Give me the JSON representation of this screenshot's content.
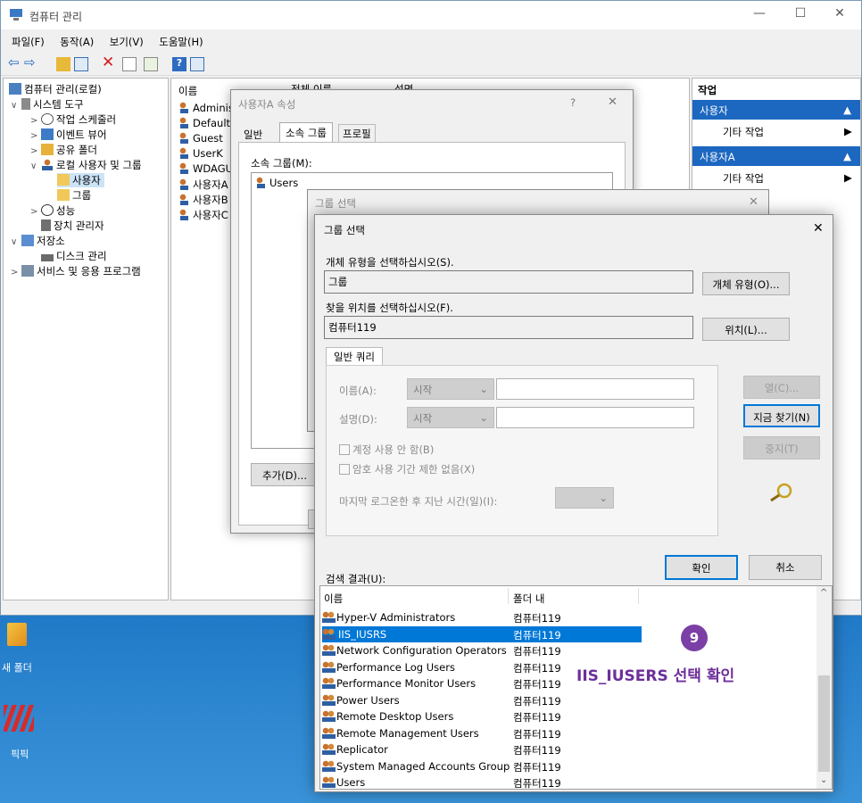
{
  "window": {
    "title": "컴퓨터 관리",
    "controls": [
      "—",
      "☐",
      "✕"
    ]
  },
  "menu": [
    "파일(F)",
    "동작(A)",
    "보기(V)",
    "도움말(H)"
  ],
  "tree": {
    "items": [
      {
        "label": "컴퓨터 관리(로컬)",
        "arrow": ""
      },
      {
        "label": "시스템 도구",
        "arrow": "∨"
      },
      {
        "label": "작업 스케줄러",
        "arrow": ">"
      },
      {
        "label": "이벤트 뷰어",
        "arrow": ">"
      },
      {
        "label": "공유 폴더",
        "arrow": ">"
      },
      {
        "label": "로컬 사용자 및 그룹",
        "arrow": "∨"
      },
      {
        "label": "사용자",
        "arrow": ""
      },
      {
        "label": "그룹",
        "arrow": ""
      },
      {
        "label": "성능",
        "arrow": ">"
      },
      {
        "label": "장치 관리자",
        "arrow": ""
      },
      {
        "label": "저장소",
        "arrow": "∨"
      },
      {
        "label": "디스크 관리",
        "arrow": ""
      },
      {
        "label": "서비스 및 응용 프로그램",
        "arrow": ">"
      }
    ]
  },
  "list": {
    "columns": [
      "이름",
      "전체 이름",
      "설명"
    ],
    "rows": [
      "Adminis",
      "DefaultA",
      "Guest",
      "UserK",
      "WDAGU",
      "사용자A",
      "사용자B",
      "사용자C"
    ]
  },
  "actions": {
    "header": "작업",
    "sections": [
      {
        "title": "사용자",
        "item": "기타 작업"
      },
      {
        "title": "사용자A",
        "item": "기타 작업"
      }
    ]
  },
  "desktop": {
    "folder_label": "새 폴더",
    "app_label": "픽픽"
  },
  "prop_dialog": {
    "title": "사용자A 속성",
    "help": "?",
    "close": "✕",
    "tabs": [
      "일반",
      "소속 그룹",
      "프로필"
    ],
    "member_of_label": "소속 그룹(M):",
    "members": [
      "Users"
    ],
    "add_button": "추가(D)..."
  },
  "group_select_back": {
    "title": "그룹 선택",
    "close": "✕"
  },
  "group_select": {
    "title": "그룹 선택",
    "close": "✕",
    "object_type_label": "개체 유형을 선택하십시오(S).",
    "object_type_value": "그룹",
    "object_type_button": "개체 유형(O)...",
    "location_label": "찾을 위치를 선택하십시오(F).",
    "location_value": "컴퓨터119",
    "location_button": "위치(L)...",
    "query_tab": "일반 쿼리",
    "name_label": "이름(A):",
    "name_combo": "시작",
    "desc_label": "설명(D):",
    "desc_combo": "시작",
    "disabled_accounts": "계정 사용 안 함(B)",
    "no_expire": "암호 사용 기간 제한 없음(X)",
    "last_logon": "마지막 로그온한 후 지난 시간(일)(I):",
    "columns_button": "열(C)...",
    "find_now_button": "지금 찾기(N)",
    "stop_button": "중지(T)",
    "ok_button": "확인",
    "cancel_button": "취소",
    "results_label": "검색 결과(U):",
    "results_columns": [
      "이름",
      "폴더 내"
    ],
    "results": [
      {
        "name": "Hyper-V Administrators",
        "folder": "컴퓨터119"
      },
      {
        "name": "IIS_IUSRS",
        "folder": "컴퓨터119",
        "selected": true
      },
      {
        "name": "Network Configuration Operators",
        "folder": "컴퓨터119"
      },
      {
        "name": "Performance Log Users",
        "folder": "컴퓨터119"
      },
      {
        "name": "Performance Monitor Users",
        "folder": "컴퓨터119"
      },
      {
        "name": "Power Users",
        "folder": "컴퓨터119"
      },
      {
        "name": "Remote Desktop Users",
        "folder": "컴퓨터119"
      },
      {
        "name": "Remote Management Users",
        "folder": "컴퓨터119"
      },
      {
        "name": "Replicator",
        "folder": "컴퓨터119"
      },
      {
        "name": "System Managed Accounts Group",
        "folder": "컴퓨터119"
      },
      {
        "name": "Users",
        "folder": "컴퓨터119"
      }
    ]
  },
  "annotation": {
    "badge": "9",
    "text": "IIS_IUSERS 선택 확인",
    "color": "#6d2f99"
  },
  "colors": {
    "accent": "#0078d7",
    "action_header": "#1c67c0"
  }
}
